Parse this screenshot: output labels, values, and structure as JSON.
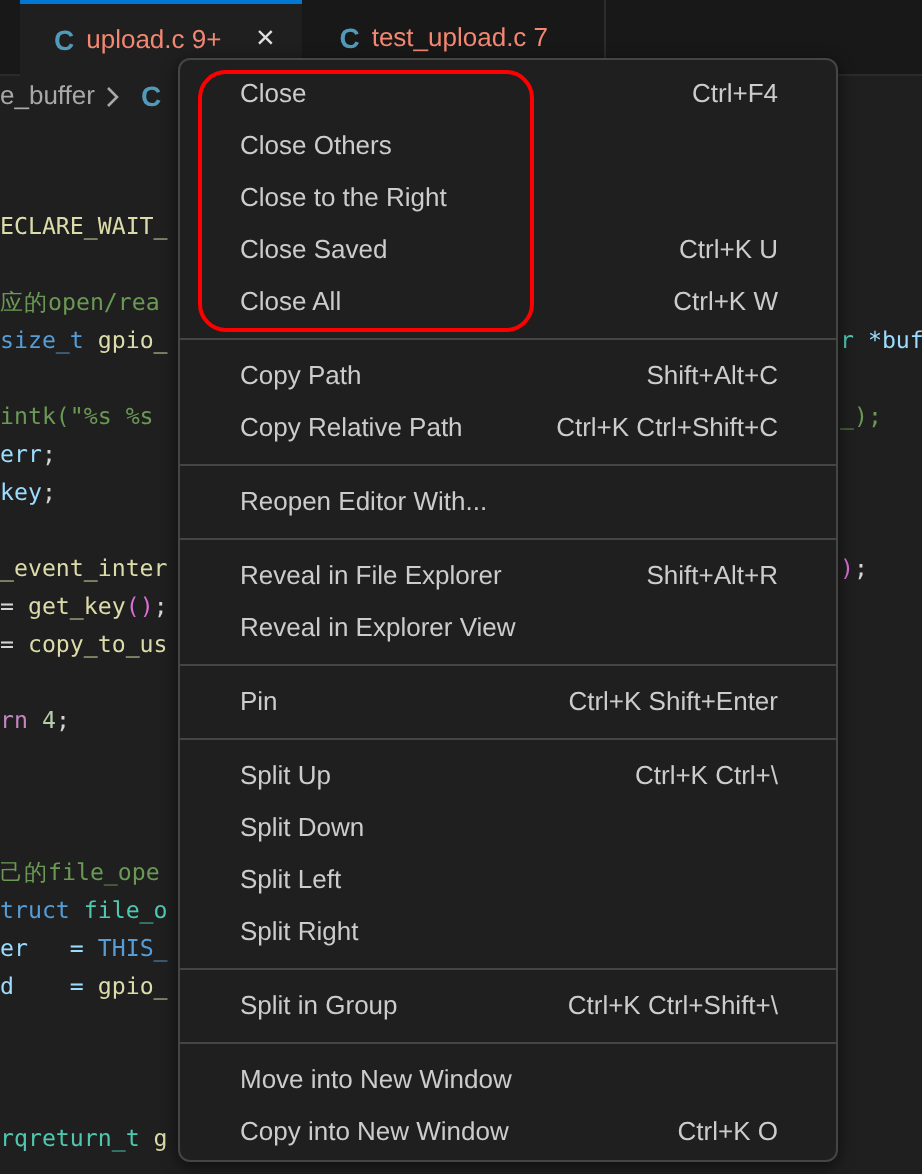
{
  "tabs": [
    {
      "icon": "C",
      "label": "upload.c 9+",
      "selected": true,
      "close": "×"
    },
    {
      "icon": "C",
      "label": "test_upload.c 7",
      "selected": false
    }
  ],
  "breadcrumb": {
    "text": "e_buffer",
    "icon": "C"
  },
  "code_lines": [
    {
      "kind": "code",
      "segments": [
        {
          "text": "ECLARE_WAIT_",
          "color": "#dcdcaa"
        }
      ]
    },
    {
      "kind": "blank"
    },
    {
      "kind": "code",
      "segments": [
        {
          "text": "应的open/rea",
          "color": "#6a9955"
        }
      ]
    },
    {
      "kind": "code",
      "segments": [
        {
          "text": "size_t ",
          "color": "#569cd6"
        },
        {
          "text": "gpio_",
          "color": "#dcdcaa"
        }
      ],
      "right": [
        {
          "text": "r ",
          "color": "#4ec9b0"
        },
        {
          "text": "*buf",
          "color": "#9cdcfe"
        }
      ]
    },
    {
      "kind": "blank"
    },
    {
      "kind": "code",
      "segments": [
        {
          "text": "intk(\"%s %s",
          "color": "#6a9955"
        }
      ],
      "right": [
        {
          "text": "_);",
          "color": "#6a9955"
        }
      ]
    },
    {
      "kind": "code",
      "segments": [
        {
          "text": "err",
          "color": "#9cdcfe"
        },
        {
          "text": ";",
          "color": "#d4d4d4"
        }
      ]
    },
    {
      "kind": "code",
      "segments": [
        {
          "text": "key",
          "color": "#9cdcfe"
        },
        {
          "text": ";",
          "color": "#d4d4d4"
        }
      ]
    },
    {
      "kind": "blank"
    },
    {
      "kind": "code",
      "segments": [
        {
          "text": "_event_inter",
          "color": "#dcdcaa"
        }
      ],
      "right": [
        {
          "text": ")",
          "color": "#da70d6"
        },
        {
          "text": ";",
          "color": "#d4d4d4"
        }
      ]
    },
    {
      "kind": "code",
      "segments": [
        {
          "text": "= ",
          "color": "#d4d4d4"
        },
        {
          "text": "get_key",
          "color": "#dcdcaa"
        },
        {
          "text": "()",
          "color": "#da70d6"
        },
        {
          "text": ";",
          "color": "#d4d4d4"
        }
      ]
    },
    {
      "kind": "code",
      "segments": [
        {
          "text": "= ",
          "color": "#d4d4d4"
        },
        {
          "text": "copy_to_us",
          "color": "#dcdcaa"
        }
      ]
    },
    {
      "kind": "blank"
    },
    {
      "kind": "code",
      "segments": [
        {
          "text": "rn ",
          "color": "#c586c0"
        },
        {
          "text": "4",
          "color": "#b5cea8"
        },
        {
          "text": ";",
          "color": "#d4d4d4"
        }
      ]
    },
    {
      "kind": "blank"
    },
    {
      "kind": "blank"
    },
    {
      "kind": "blank"
    },
    {
      "kind": "code",
      "segments": [
        {
          "text": "己的file_ope",
          "color": "#6a9955"
        }
      ]
    },
    {
      "kind": "code",
      "segments": [
        {
          "text": "truct ",
          "color": "#569cd6"
        },
        {
          "text": "file_o",
          "color": "#4ec9b0"
        }
      ]
    },
    {
      "kind": "code",
      "segments": [
        {
          "text": "er   = ",
          "color": "#9cdcfe"
        },
        {
          "text": "THIS_",
          "color": "#569cd6"
        }
      ]
    },
    {
      "kind": "code",
      "segments": [
        {
          "text": "d    = ",
          "color": "#9cdcfe"
        },
        {
          "text": "gpio_",
          "color": "#dcdcaa"
        }
      ]
    },
    {
      "kind": "blank"
    },
    {
      "kind": "blank"
    },
    {
      "kind": "blank"
    },
    {
      "kind": "code",
      "segments": [
        {
          "text": "rqreturn_t ",
          "color": "#4ec9b0"
        },
        {
          "text": "g",
          "color": "#dcdcaa"
        }
      ]
    }
  ],
  "context_menu": {
    "groups": [
      [
        {
          "label": "Close",
          "shortcut": "Ctrl+F4"
        },
        {
          "label": "Close Others"
        },
        {
          "label": "Close to the Right"
        },
        {
          "label": "Close Saved",
          "shortcut": "Ctrl+K U"
        },
        {
          "label": "Close All",
          "shortcut": "Ctrl+K W"
        }
      ],
      [
        {
          "label": "Copy Path",
          "shortcut": "Shift+Alt+C"
        },
        {
          "label": "Copy Relative Path",
          "shortcut": "Ctrl+K Ctrl+Shift+C"
        }
      ],
      [
        {
          "label": "Reopen Editor With..."
        }
      ],
      [
        {
          "label": "Reveal in File Explorer",
          "shortcut": "Shift+Alt+R"
        },
        {
          "label": "Reveal in Explorer View"
        }
      ],
      [
        {
          "label": "Pin",
          "shortcut": "Ctrl+K Shift+Enter"
        }
      ],
      [
        {
          "label": "Split Up",
          "shortcut": "Ctrl+K Ctrl+\\"
        },
        {
          "label": "Split Down"
        },
        {
          "label": "Split Left"
        },
        {
          "label": "Split Right"
        }
      ],
      [
        {
          "label": "Split in Group",
          "shortcut": "Ctrl+K Ctrl+Shift+\\"
        }
      ],
      [
        {
          "label": "Move into New Window"
        },
        {
          "label": "Copy into New Window",
          "shortcut": "Ctrl+K O"
        }
      ]
    ]
  }
}
